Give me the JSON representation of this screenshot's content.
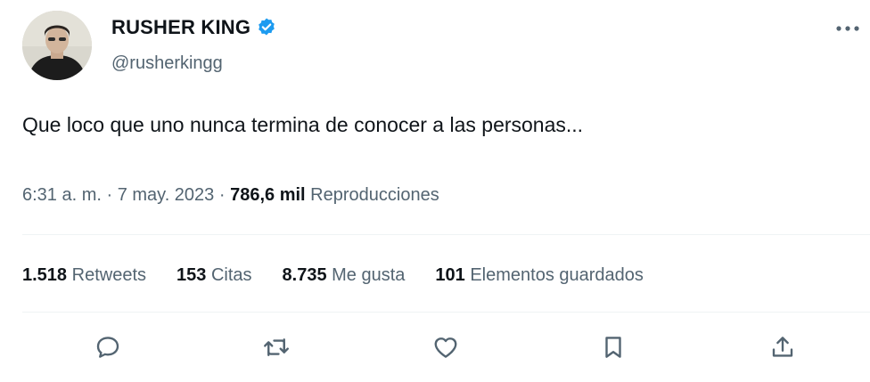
{
  "author": {
    "name": "RUSHER KING",
    "handle": "@rusherkingg",
    "verified": true,
    "verified_color": "#1d9bf0"
  },
  "tweet": {
    "text": "Que loco que uno nunca termina de conocer a las personas...",
    "time": "6:31 a. m.",
    "date": "7 may. 2023",
    "views_count": "786,6 mil",
    "views_label": "Reproducciones"
  },
  "stats": [
    {
      "count": "1.518",
      "label": "Retweets"
    },
    {
      "count": "153",
      "label": "Citas"
    },
    {
      "count": "8.735",
      "label": "Me gusta"
    },
    {
      "count": "101",
      "label": "Elementos guardados"
    }
  ],
  "actions": [
    "reply-icon",
    "retweet-icon",
    "like-icon",
    "bookmark-icon",
    "share-icon"
  ],
  "colors": {
    "text": "#0f1419",
    "secondary": "#536471",
    "divider": "#eff3f4"
  }
}
